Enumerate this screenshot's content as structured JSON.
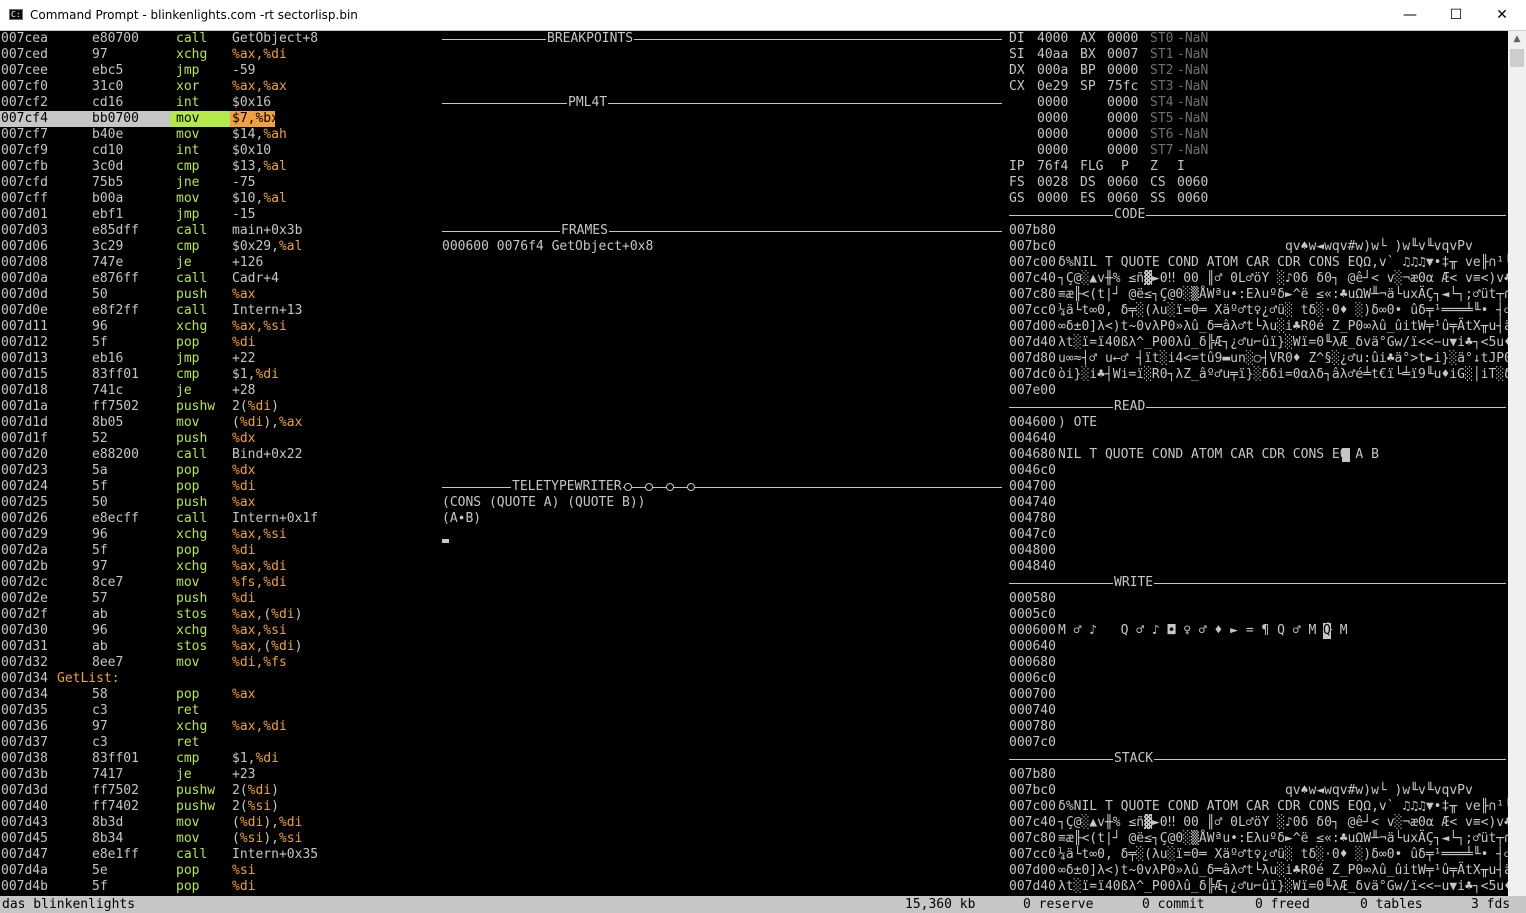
{
  "window": {
    "title": "Command Prompt - blinkenlights.com  -rt sectorlisp.bin",
    "icon": "terminal-icon",
    "minimize_glyph": "—",
    "maximize_glyph": "☐",
    "close_glyph": "✕"
  },
  "colors": {
    "text": "#c6c6c6",
    "mnemonic": "#b4e84b",
    "register": "#f0a040",
    "dim": "#707070",
    "background": "#000000"
  },
  "disasm": [
    {
      "addr": "007cea",
      "hex": "e80700",
      "op": "call",
      "args": [
        {
          "t": "GetObject+8",
          "c": "wht"
        }
      ]
    },
    {
      "addr": "007ced",
      "hex": "97",
      "op": "xchg",
      "args": [
        {
          "t": "%ax,%di",
          "c": "org"
        }
      ]
    },
    {
      "addr": "007cee",
      "hex": "ebc5",
      "op": "jmp",
      "args": [
        {
          "t": "-59",
          "c": "wht"
        }
      ]
    },
    {
      "addr": "007cf0",
      "hex": "31c0",
      "op": "xor",
      "args": [
        {
          "t": "%ax,%ax",
          "c": "org"
        }
      ]
    },
    {
      "addr": "007cf2",
      "hex": "cd16",
      "op": "int",
      "args": [
        {
          "t": "$0x16",
          "c": "wht"
        }
      ]
    },
    {
      "addr": "007cf4",
      "hex": "bb0700",
      "op": "mov",
      "args": [
        {
          "t": "$7,",
          "c": "wht"
        },
        {
          "t": "%bx",
          "c": "org"
        }
      ]
    },
    {
      "addr": "007cf7",
      "hex": "b40e",
      "op": "mov",
      "args": [
        {
          "t": "$14,",
          "c": "wht"
        },
        {
          "t": "%ah",
          "c": "org"
        }
      ]
    },
    {
      "addr": "007cf9",
      "hex": "cd10",
      "op": "int",
      "args": [
        {
          "t": "$0x10",
          "c": "wht"
        }
      ]
    },
    {
      "addr": "007cfb",
      "hex": "3c0d",
      "op": "cmp",
      "args": [
        {
          "t": "$13,",
          "c": "wht"
        },
        {
          "t": "%al",
          "c": "org"
        }
      ]
    },
    {
      "addr": "007cfd",
      "hex": "75b5",
      "op": "jne",
      "args": [
        {
          "t": "-75",
          "c": "wht"
        }
      ]
    },
    {
      "addr": "007cff",
      "hex": "b00a",
      "op": "mov",
      "args": [
        {
          "t": "$10,",
          "c": "wht"
        },
        {
          "t": "%al",
          "c": "org"
        }
      ]
    },
    {
      "addr": "007d01",
      "hex": "ebf1",
      "op": "jmp",
      "args": [
        {
          "t": "-15",
          "c": "wht"
        }
      ]
    },
    {
      "addr": "007d03",
      "hex": "e85dff",
      "op": "call",
      "args": [
        {
          "t": "main+0x3b",
          "c": "wht"
        }
      ]
    },
    {
      "addr": "007d06",
      "hex": "3c29",
      "op": "cmp",
      "args": [
        {
          "t": "$0x29,",
          "c": "wht"
        },
        {
          "t": "%al",
          "c": "org"
        }
      ]
    },
    {
      "addr": "007d08",
      "hex": "747e",
      "op": "je",
      "args": [
        {
          "t": "+126",
          "c": "wht"
        }
      ]
    },
    {
      "addr": "007d0a",
      "hex": "e876ff",
      "op": "call",
      "args": [
        {
          "t": "Cadr+4",
          "c": "wht"
        }
      ]
    },
    {
      "addr": "007d0d",
      "hex": "50",
      "op": "push",
      "args": [
        {
          "t": "%ax",
          "c": "org"
        }
      ]
    },
    {
      "addr": "007d0e",
      "hex": "e8f2ff",
      "op": "call",
      "args": [
        {
          "t": "Intern+13",
          "c": "wht"
        }
      ]
    },
    {
      "addr": "007d11",
      "hex": "96",
      "op": "xchg",
      "args": [
        {
          "t": "%ax,%si",
          "c": "org"
        }
      ]
    },
    {
      "addr": "007d12",
      "hex": "5f",
      "op": "pop",
      "args": [
        {
          "t": "%di",
          "c": "org"
        }
      ]
    },
    {
      "addr": "007d13",
      "hex": "eb16",
      "op": "jmp",
      "args": [
        {
          "t": "+22",
          "c": "wht"
        }
      ]
    },
    {
      "addr": "007d15",
      "hex": "83ff01",
      "op": "cmp",
      "args": [
        {
          "t": "$1,",
          "c": "wht"
        },
        {
          "t": "%di",
          "c": "org"
        }
      ]
    },
    {
      "addr": "007d18",
      "hex": "741c",
      "op": "je",
      "args": [
        {
          "t": "+28",
          "c": "wht"
        }
      ]
    },
    {
      "addr": "007d1a",
      "hex": "ff7502",
      "op": "pushw",
      "args": [
        {
          "t": "2(",
          "c": "wht"
        },
        {
          "t": "%di",
          "c": "org"
        },
        {
          "t": ")",
          "c": "wht"
        }
      ]
    },
    {
      "addr": "007d1d",
      "hex": "8b05",
      "op": "mov",
      "args": [
        {
          "t": "(",
          "c": "wht"
        },
        {
          "t": "%di",
          "c": "org"
        },
        {
          "t": "),",
          "c": "wht"
        },
        {
          "t": "%ax",
          "c": "org"
        }
      ]
    },
    {
      "addr": "007d1f",
      "hex": "52",
      "op": "push",
      "args": [
        {
          "t": "%dx",
          "c": "org"
        }
      ]
    },
    {
      "addr": "007d20",
      "hex": "e88200",
      "op": "call",
      "args": [
        {
          "t": "Bind+0x22",
          "c": "wht"
        }
      ]
    },
    {
      "addr": "007d23",
      "hex": "5a",
      "op": "pop",
      "args": [
        {
          "t": "%dx",
          "c": "org"
        }
      ]
    },
    {
      "addr": "007d24",
      "hex": "5f",
      "op": "pop",
      "args": [
        {
          "t": "%di",
          "c": "org"
        }
      ]
    },
    {
      "addr": "007d25",
      "hex": "50",
      "op": "push",
      "args": [
        {
          "t": "%ax",
          "c": "org"
        }
      ]
    },
    {
      "addr": "007d26",
      "hex": "e8ecff",
      "op": "call",
      "args": [
        {
          "t": "Intern+0x1f",
          "c": "wht"
        }
      ]
    },
    {
      "addr": "007d29",
      "hex": "96",
      "op": "xchg",
      "args": [
        {
          "t": "%ax,%si",
          "c": "org"
        }
      ]
    },
    {
      "addr": "007d2a",
      "hex": "5f",
      "op": "pop",
      "args": [
        {
          "t": "%di",
          "c": "org"
        }
      ]
    },
    {
      "addr": "007d2b",
      "hex": "97",
      "op": "xchg",
      "args": [
        {
          "t": "%ax,%di",
          "c": "org"
        }
      ]
    },
    {
      "addr": "007d2c",
      "hex": "8ce7",
      "op": "mov",
      "args": [
        {
          "t": "%fs,%di",
          "c": "org"
        }
      ]
    },
    {
      "addr": "007d2e",
      "hex": "57",
      "op": "push",
      "args": [
        {
          "t": "%di",
          "c": "org"
        }
      ]
    },
    {
      "addr": "007d2f",
      "hex": "ab",
      "op": "stos",
      "args": [
        {
          "t": "%ax,",
          "c": "org"
        },
        {
          "t": "(",
          "c": "wht"
        },
        {
          "t": "%di",
          "c": "org"
        },
        {
          "t": ")",
          "c": "wht"
        }
      ]
    },
    {
      "addr": "007d30",
      "hex": "96",
      "op": "xchg",
      "args": [
        {
          "t": "%ax,%si",
          "c": "org"
        }
      ]
    },
    {
      "addr": "007d31",
      "hex": "ab",
      "op": "stos",
      "args": [
        {
          "t": "%ax,",
          "c": "org"
        },
        {
          "t": "(",
          "c": "wht"
        },
        {
          "t": "%di",
          "c": "org"
        },
        {
          "t": ")",
          "c": "wht"
        }
      ]
    },
    {
      "addr": "007d32",
      "hex": "8ee7",
      "op": "mov",
      "args": [
        {
          "t": "%di,%fs",
          "c": "org"
        }
      ]
    },
    {
      "addr": "007d34",
      "label": "GetList:"
    },
    {
      "addr": "007d34",
      "hex": "58",
      "op": "pop",
      "args": [
        {
          "t": "%ax",
          "c": "org"
        }
      ]
    },
    {
      "addr": "007d35",
      "hex": "c3",
      "op": "ret",
      "args": []
    },
    {
      "addr": "007d36",
      "hex": "97",
      "op": "xchg",
      "args": [
        {
          "t": "%ax,%di",
          "c": "org"
        }
      ]
    },
    {
      "addr": "007d37",
      "hex": "c3",
      "op": "ret",
      "args": []
    },
    {
      "addr": "007d38",
      "hex": "83ff01",
      "op": "cmp",
      "args": [
        {
          "t": "$1,",
          "c": "wht"
        },
        {
          "t": "%di",
          "c": "org"
        }
      ]
    },
    {
      "addr": "007d3b",
      "hex": "7417",
      "op": "je",
      "args": [
        {
          "t": "+23",
          "c": "wht"
        }
      ]
    },
    {
      "addr": "007d3d",
      "hex": "ff7502",
      "op": "pushw",
      "args": [
        {
          "t": "2(",
          "c": "wht"
        },
        {
          "t": "%di",
          "c": "org"
        },
        {
          "t": ")",
          "c": "wht"
        }
      ]
    },
    {
      "addr": "007d40",
      "hex": "ff7402",
      "op": "pushw",
      "args": [
        {
          "t": "2(",
          "c": "wht"
        },
        {
          "t": "%si",
          "c": "org"
        },
        {
          "t": ")",
          "c": "wht"
        }
      ]
    },
    {
      "addr": "007d43",
      "hex": "8b3d",
      "op": "mov",
      "args": [
        {
          "t": "(",
          "c": "wht"
        },
        {
          "t": "%di",
          "c": "org"
        },
        {
          "t": "),",
          "c": "wht"
        },
        {
          "t": "%di",
          "c": "org"
        }
      ]
    },
    {
      "addr": "007d45",
      "hex": "8b34",
      "op": "mov",
      "args": [
        {
          "t": "(",
          "c": "wht"
        },
        {
          "t": "%si",
          "c": "org"
        },
        {
          "t": "),",
          "c": "wht"
        },
        {
          "t": "%si",
          "c": "org"
        }
      ]
    },
    {
      "addr": "007d47",
      "hex": "e8e1ff",
      "op": "call",
      "args": [
        {
          "t": "Intern+0x35",
          "c": "wht"
        }
      ]
    },
    {
      "addr": "007d4a",
      "hex": "5e",
      "op": "pop",
      "args": [
        {
          "t": "%si",
          "c": "org"
        }
      ]
    },
    {
      "addr": "007d4b",
      "hex": "5f",
      "op": "pop",
      "args": [
        {
          "t": "%di",
          "c": "org"
        }
      ]
    }
  ],
  "panels": {
    "breakpoints": "BREAKPOINTS",
    "pml4t": "PML4T",
    "frames": "FRAMES",
    "frame_rows": [
      "000600 0076f4 GetObject+0x8"
    ],
    "teletypewriter": "TELETYPEWRITER",
    "tty_lines": [
      "(CONS (QUOTE A) (QUOTE B))",
      "(A∙B)"
    ],
    "code": "CODE",
    "read": "READ",
    "write": "WRITE",
    "stack": "STACK"
  },
  "registers": {
    "rows": [
      [
        {
          "t": "DI",
          "c": "wht"
        },
        {
          "t": "4000",
          "c": "wht"
        },
        {
          "t": "AX",
          "c": "wht"
        },
        {
          "t": "0000",
          "c": "wht"
        },
        {
          "t": "ST0",
          "c": "gry"
        },
        {
          "t": "-NaN",
          "c": "gry"
        }
      ],
      [
        {
          "t": "SI",
          "c": "wht"
        },
        {
          "t": "40aa",
          "c": "wht"
        },
        {
          "t": "BX",
          "c": "wht"
        },
        {
          "t": "0007",
          "c": "wht"
        },
        {
          "t": "ST1",
          "c": "gry"
        },
        {
          "t": "-NaN",
          "c": "gry"
        }
      ],
      [
        {
          "t": "DX",
          "c": "wht"
        },
        {
          "t": "000a",
          "c": "wht"
        },
        {
          "t": "BP",
          "c": "wht"
        },
        {
          "t": "0000",
          "c": "wht"
        },
        {
          "t": "ST2",
          "c": "gry"
        },
        {
          "t": "-NaN",
          "c": "gry"
        }
      ],
      [
        {
          "t": "CX",
          "c": "wht"
        },
        {
          "t": "0e29",
          "c": "wht"
        },
        {
          "t": "SP",
          "c": "wht"
        },
        {
          "t": "75fc",
          "c": "wht"
        },
        {
          "t": "ST3",
          "c": "gry"
        },
        {
          "t": "-NaN",
          "c": "gry"
        }
      ],
      [
        {
          "t": "",
          "c": "wht"
        },
        {
          "t": "0000",
          "c": "wht"
        },
        {
          "t": "",
          "c": "wht"
        },
        {
          "t": "0000",
          "c": "wht"
        },
        {
          "t": "ST4",
          "c": "gry"
        },
        {
          "t": "-NaN",
          "c": "gry"
        }
      ],
      [
        {
          "t": "",
          "c": "wht"
        },
        {
          "t": "0000",
          "c": "wht"
        },
        {
          "t": "",
          "c": "wht"
        },
        {
          "t": "0000",
          "c": "wht"
        },
        {
          "t": "ST5",
          "c": "gry"
        },
        {
          "t": "-NaN",
          "c": "gry"
        }
      ],
      [
        {
          "t": "",
          "c": "wht"
        },
        {
          "t": "0000",
          "c": "wht"
        },
        {
          "t": "",
          "c": "wht"
        },
        {
          "t": "0000",
          "c": "wht"
        },
        {
          "t": "ST6",
          "c": "gry"
        },
        {
          "t": "-NaN",
          "c": "gry"
        }
      ],
      [
        {
          "t": "",
          "c": "wht"
        },
        {
          "t": "0000",
          "c": "wht"
        },
        {
          "t": "",
          "c": "wht"
        },
        {
          "t": "0000",
          "c": "wht"
        },
        {
          "t": "ST7",
          "c": "gry"
        },
        {
          "t": "-NaN",
          "c": "gry"
        }
      ],
      [
        {
          "t": "IP",
          "c": "wht"
        },
        {
          "t": "76f4",
          "c": "wht"
        },
        {
          "t": "FLG",
          "c": "wht"
        },
        {
          "t": "P",
          "c": "wht"
        },
        {
          "t": "Z",
          "c": "wht"
        },
        {
          "t": "I",
          "c": "wht"
        }
      ],
      [
        {
          "t": "FS",
          "c": "wht"
        },
        {
          "t": "0028",
          "c": "wht"
        },
        {
          "t": "DS",
          "c": "wht"
        },
        {
          "t": "0060",
          "c": "wht"
        },
        {
          "t": "CS",
          "c": "wht"
        },
        {
          "t": "0060",
          "c": "wht"
        }
      ],
      [
        {
          "t": "GS",
          "c": "wht"
        },
        {
          "t": "0000",
          "c": "wht"
        },
        {
          "t": "ES",
          "c": "wht"
        },
        {
          "t": "0060",
          "c": "wht"
        },
        {
          "t": "SS",
          "c": "wht"
        },
        {
          "t": "0060",
          "c": "wht"
        }
      ]
    ]
  },
  "code_rows": [
    {
      "addr": "007b80",
      "text": ""
    },
    {
      "addr": "007bc0",
      "text": "                             qv♠w◄wqv#w)w└ )w╙v╙vqvPv"
    },
    {
      "addr": "007c00",
      "text": "δ%NIL T QUOTE COND ATOM CAR CDR CONS EQΩ,v` ♫♫♫▼•‡╥ ve╟∩¹└ÄαΓλ≤→"
    },
    {
      "addr": "007c40",
      "text": "┐Ç@░▲v╫% ≤ñ▓►0‼ 00 ║♂ 0L♂öY ░♪0δ δ0┐ @ê┘< v░¬æ0α Æ< v≡<)v♣Ç×)wté"
    },
    {
      "addr": "007c80",
      "text": "≡æ╟<(t|┘ @ë≤┐Ç@0░▒ÅWªu•:Eλuºδ►^ë ≤«:♣uΩW╨¬ä└uxÄÇ┐◄└┐;♂üt┬∩▒┤Ç@"
    },
    {
      "addr": "007cc0",
      "text": "¼ä└t∞0, δ╤░(λu░ï=0═ Xäº♂t♀¿♂ü░ tδ░·0♦ ░)δ∞0• ûδ╤¹═══╧╙• ┤♂═►<→u░"
    },
    {
      "addr": "007d00",
      "text": "∞δ±0]λ<)t~0vλP0»λû_δ═âλ♂t└λu░i♣R0é Z_P0∞λû_ûitW╤¹û╤ÄtX╥u┤äλ♂t╤λu░"
    },
    {
      "addr": "007d40",
      "text": "λt░ï=ï40ßλ^_P00λû_δ╠Æ┐¿♂u⌐ûï}░Wï=0╙λÆ_δvä°Gw/ï<<−u▼i♣┐<5u♦ïE░┐<#"
    },
    {
      "addr": "007d80",
      "text": "u∞≈┤♂ u←♂ ┤ït░i4<=tû9▬un░○┤VR0♦ Z^§░¿♂u:ûi♣ä°>t►i}░ä°↓tJP0XλûXδ"
    },
    {
      "addr": "007dc0",
      "text": "òi}░i♣┤Wi=ï░R0┐λZ_âº♂u╤ï}░δδi=0αλδ┐âλ♂é╧t€ï└╧ï9╙u♦iG░│iT░δ0╣╣╣╣┤╡"
    },
    {
      "addr": "007e00",
      "text": ""
    }
  ],
  "read_rows": [
    {
      "addr": "004600",
      "text": ") OTE"
    },
    {
      "addr": "004640",
      "text": ""
    },
    {
      "addr": "004680",
      "text": "NIL T QUOTE COND ATOM CAR CDR CONS EQ A B"
    },
    {
      "addr": "0046c0",
      "text": ""
    },
    {
      "addr": "004700",
      "text": ""
    },
    {
      "addr": "004740",
      "text": ""
    },
    {
      "addr": "004780",
      "text": ""
    },
    {
      "addr": "0047c0",
      "text": ""
    },
    {
      "addr": "004800",
      "text": ""
    },
    {
      "addr": "004840",
      "text": ""
    }
  ],
  "write_rows": [
    {
      "addr": "000580",
      "text": ""
    },
    {
      "addr": "0005c0",
      "text": ""
    },
    {
      "addr": "000600",
      "text": "M ♂ ♪   Q ♂ ♪ ◘ ♀ ♂ ♦ ► = ¶ Q ♂ M └ M "
    },
    {
      "addr": "000640",
      "text": ""
    },
    {
      "addr": "000680",
      "text": ""
    },
    {
      "addr": "0006c0",
      "text": ""
    },
    {
      "addr": "000700",
      "text": ""
    },
    {
      "addr": "000740",
      "text": ""
    },
    {
      "addr": "000780",
      "text": ""
    },
    {
      "addr": "0007c0",
      "text": ""
    }
  ],
  "write_cursor": "Q",
  "stack_rows": [
    {
      "addr": "007b80",
      "text": ""
    },
    {
      "addr": "007bc0",
      "text": "                             qv♠w◄wqv#w)w└ )w╙v╙vqvPv"
    },
    {
      "addr": "007c00",
      "text": "δ%NIL T QUOTE COND ATOM CAR CDR CONS EQΩ,v` ♫♫♫▼•‡╥ ve╟∩¹└ÄαΓλ≤→"
    },
    {
      "addr": "007c40",
      "text": "┐Ç@░▲v╫% ≤ñ▓►0‼ 00 ║♂ 0L♂öY ░♪0δ δ0┐ @ê┘< v░¬æ0α Æ< v≡<)v♣Ç×)wté"
    },
    {
      "addr": "007c80",
      "text": "≡æ╟<(t|┘ @ë≤┐Ç@0░▒ÅWªu•:Eλuºδ►^ë ≤«:♣uΩW╨¬ä└uxÄÇ┐◄└┐;♂üt┬∩▒┤Ç@"
    },
    {
      "addr": "007cc0",
      "text": "¼ä└t∞0, δ╤░(λu░ï=0═ Xäº♂t♀¿♂ü░ tδ░·0♦ ░)δ∞0• ûδ╤¹═══╧╙• ┤♂═►<→u░"
    },
    {
      "addr": "007d00",
      "text": "∞δ±0]λ<)t~0vλP0»λû_δ═âλ♂t└λu░i♣R0é Z_P0∞λû_ûitW╤¹û╤ÄtX╥u┤äλ♂t╤λu░"
    },
    {
      "addr": "007d40",
      "text": "λt░ï=ï40ßλ^_P00λû_δ╠Æ┐¿♂u⌐ûï}░Wï=0╙λÆ_δvä°Gw/ï<<−u▼i♣┐<5u♦ïE░┐<#"
    }
  ],
  "status": {
    "left": "das blinkenlights",
    "kb": "15,360 kb",
    "reserve": "0 reserve",
    "commit": "0 commit",
    "freed": "0 freed",
    "tables": "0 tables",
    "fds": "3 fds"
  }
}
